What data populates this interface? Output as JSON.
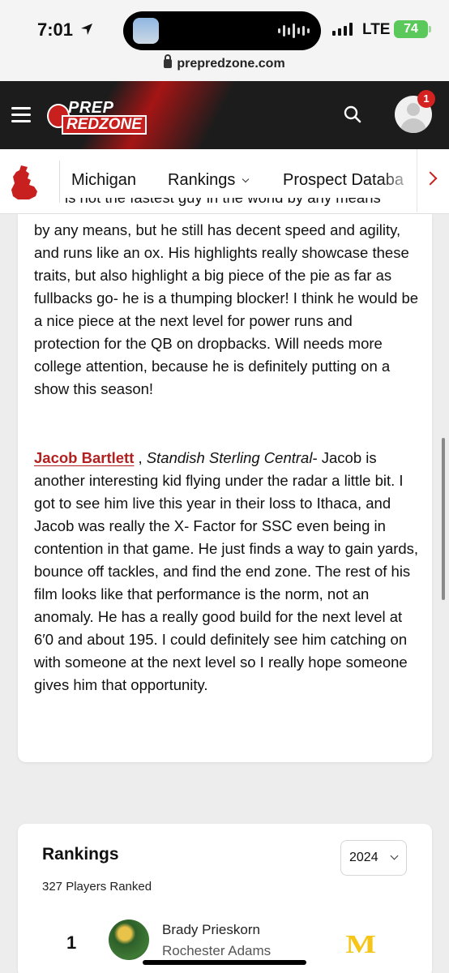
{
  "status_bar": {
    "time": "7:01",
    "network": "LTE",
    "battery": "74"
  },
  "browser": {
    "url": "prepredzone.com"
  },
  "header": {
    "logo_top": "PREP",
    "logo_bottom": "REDZONE",
    "notification_count": "1",
    "accent_color": "#c8201e"
  },
  "subnav": {
    "state_label": "Michigan",
    "rankings_label": "Rankings",
    "prospect_label": "Prospect Databa"
  },
  "article": {
    "partial_top_line": "is not the fastest guy in the world by any means",
    "paragraph1": "by any means, but he still has decent speed and agility, and runs like an ox. His highlights really showcase these traits, but also highlight a big piece of the pie as far as fullbacks go- he is a thumping blocker! I think he would be a nice piece at the next level for power runs and protection for the QB on dropbacks. Will needs more college attention, because he is definitely putting on a show this season!",
    "player_name": "Jacob Bartlett",
    "separator": " , ",
    "school": "Standish Sterling Central",
    "paragraph2": "- Jacob is another interesting kid flying under the radar a little bit. I got to see him live this year in their loss to Ithaca, and Jacob was really the X- Factor for SSC even being in contention in that game. He just finds a way to gain yards, bounce off tackles, and find the end zone. The rest of his film looks like that performance is the norm, not an anomaly. He has a really good build for the next level at 6′0 and about 195. I could definitely see him catching on with someone at the next level so I really hope someone gives him that opportunity."
  },
  "rankings": {
    "title": "Rankings",
    "players_ranked": "327 Players Ranked",
    "year": "2024",
    "top_player": {
      "rank": "1",
      "name": "Brady Prieskorn",
      "school": "Rochester Adams",
      "college_logo": "M",
      "college_color": "#f5c518"
    }
  }
}
